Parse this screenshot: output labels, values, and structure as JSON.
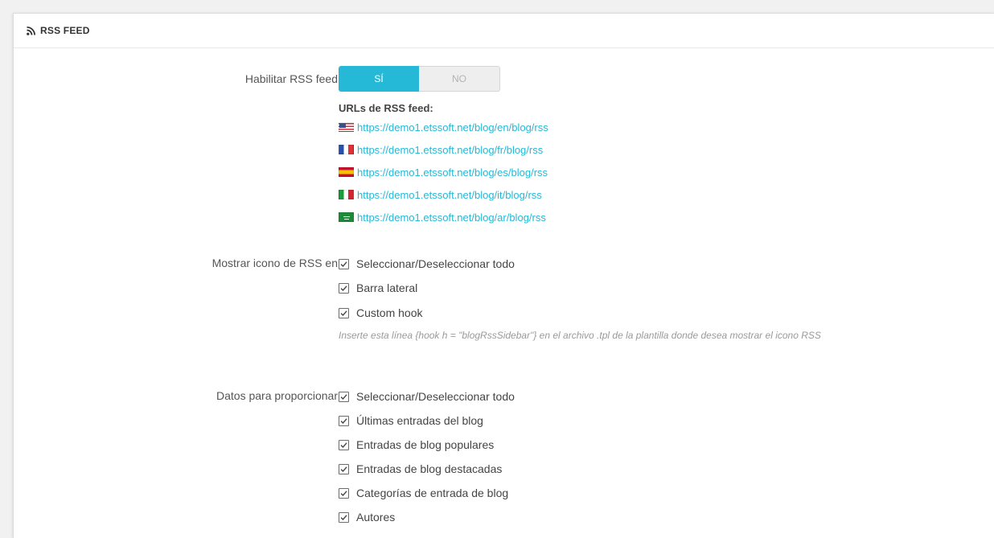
{
  "panel": {
    "title": "RSS FEED",
    "title_icon": "rss-icon"
  },
  "enable_rss": {
    "label": "Habilitar RSS feed",
    "yes_label": "SÍ",
    "no_label": "NO",
    "selected": "SÍ"
  },
  "urls": {
    "title": "URLs de RSS feed:",
    "items": [
      {
        "flag": "us-flag-icon",
        "url": "https://demo1.etssoft.net/blog/en/blog/rss"
      },
      {
        "flag": "fr-flag-icon",
        "url": "https://demo1.etssoft.net/blog/fr/blog/rss"
      },
      {
        "flag": "es-flag-icon",
        "url": "https://demo1.etssoft.net/blog/es/blog/rss"
      },
      {
        "flag": "it-flag-icon",
        "url": "https://demo1.etssoft.net/blog/it/blog/rss"
      },
      {
        "flag": "sa-flag-icon",
        "url": "https://demo1.etssoft.net/blog/ar/blog/rss"
      }
    ]
  },
  "show_icon": {
    "label": "Mostrar icono de RSS en",
    "options": [
      {
        "label": "Seleccionar/Deseleccionar todo",
        "checked": true
      },
      {
        "label": "Barra lateral",
        "checked": true
      },
      {
        "label": "Custom hook",
        "checked": true
      }
    ],
    "hint": "Inserte esta línea {hook h = \"blogRssSidebar\"} en el archivo .tpl de la plantilla donde desea mostrar el icono RSS"
  },
  "data_provide": {
    "label": "Datos para proporcionar",
    "options": [
      {
        "label": "Seleccionar/Deseleccionar todo",
        "checked": true
      },
      {
        "label": "Últimas entradas del blog",
        "checked": true
      },
      {
        "label": "Entradas de blog populares",
        "checked": true
      },
      {
        "label": "Entradas de blog destacadas",
        "checked": true
      },
      {
        "label": "Categorías de entrada de blog",
        "checked": true
      },
      {
        "label": "Autores",
        "checked": true
      }
    ]
  },
  "colors": {
    "accent": "#25b9d7",
    "link": "#25b9d7"
  }
}
